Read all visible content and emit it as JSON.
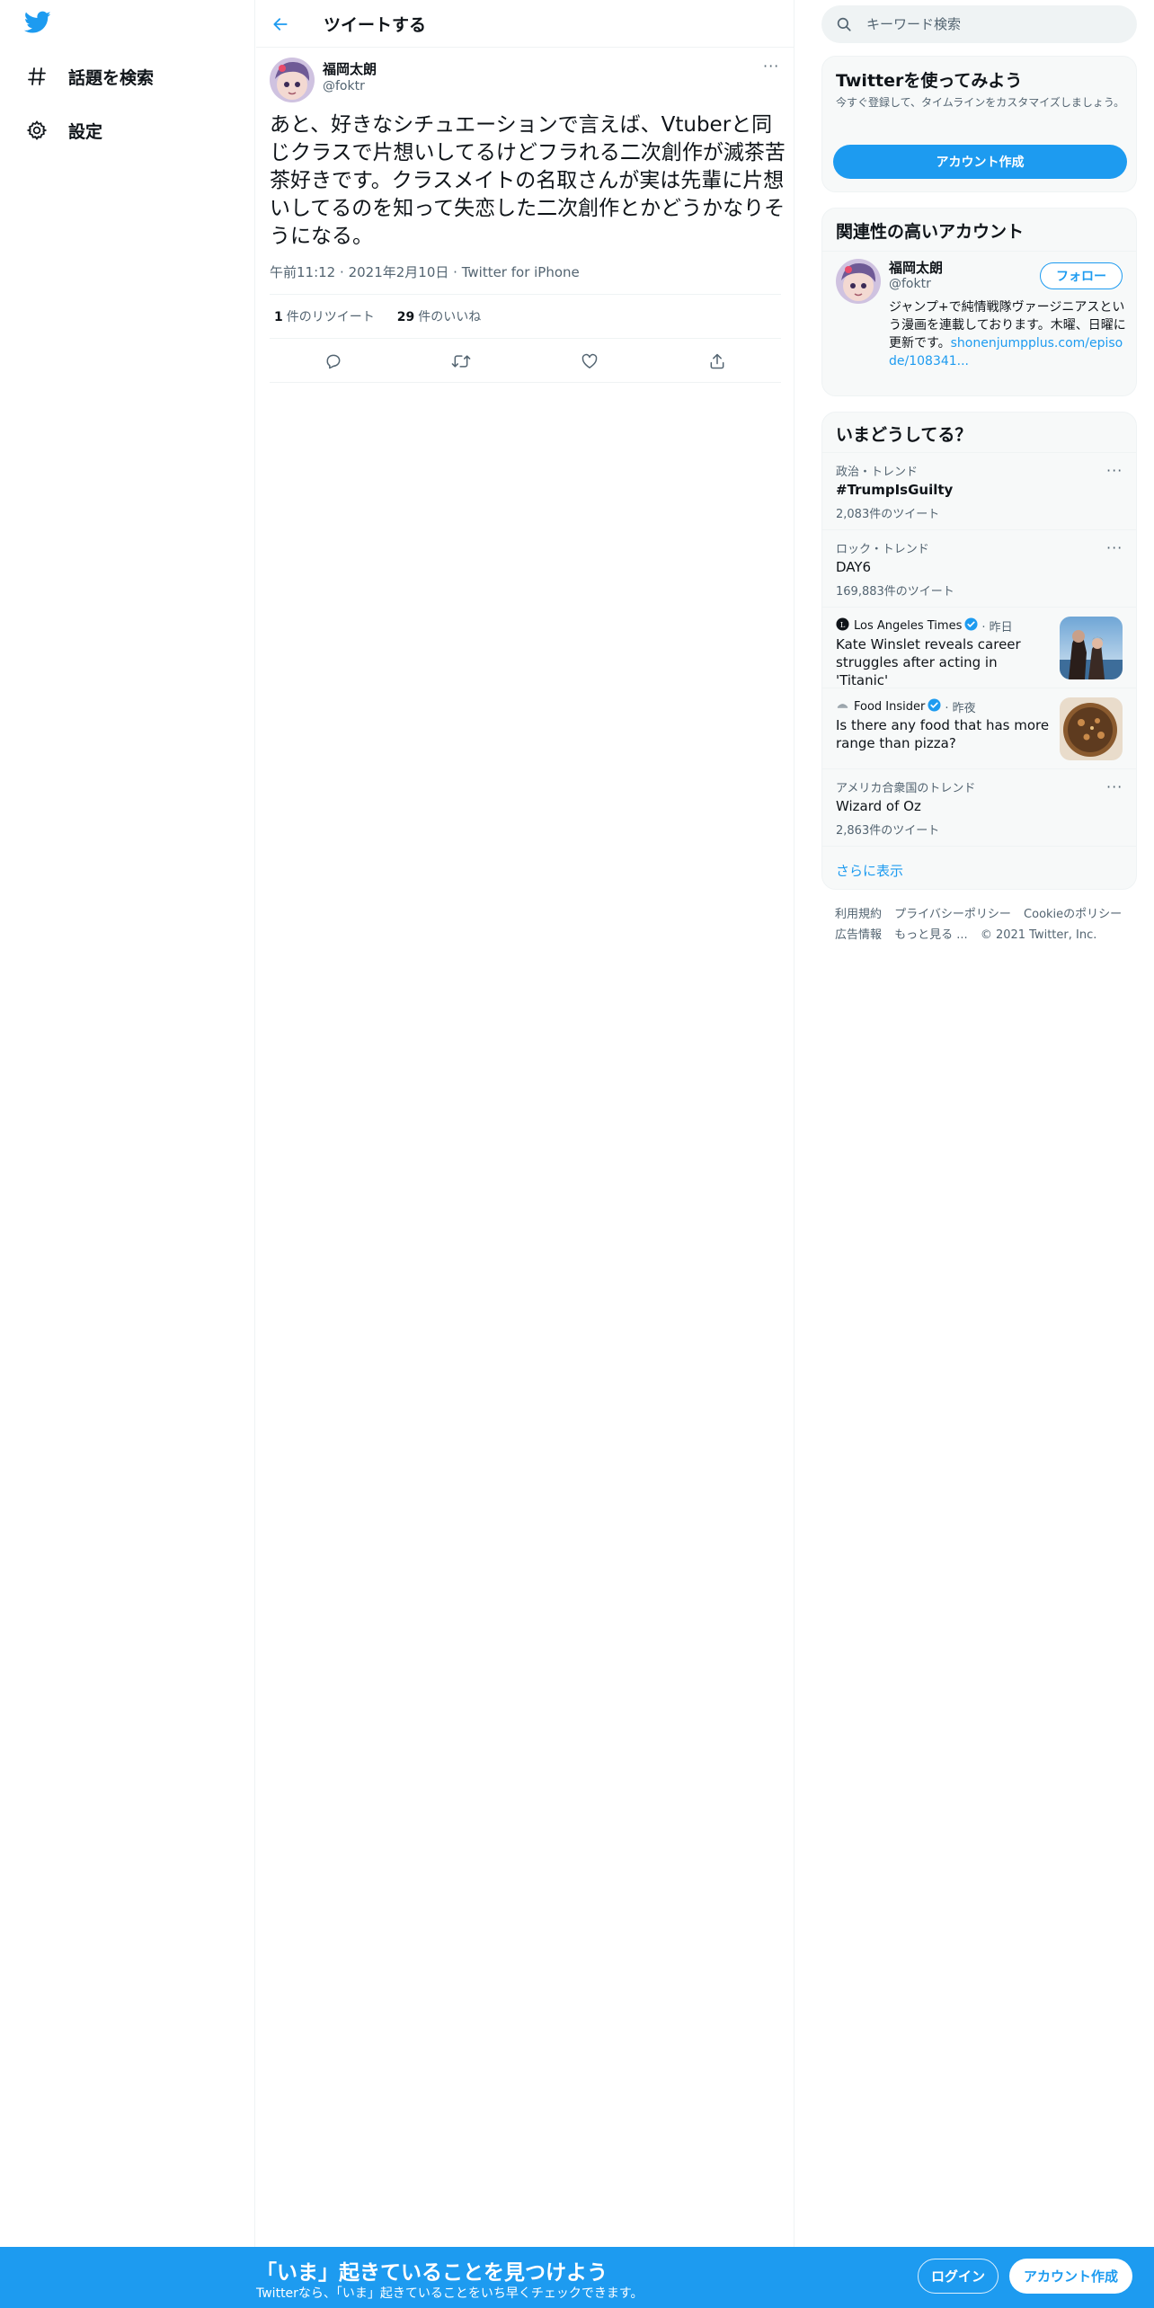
{
  "colors": {
    "accent": "#1d9bf0",
    "text": "#0f1419",
    "secondary": "#536471",
    "border": "#eff3f4",
    "panel": "#f7f9f9"
  },
  "left_nav": {
    "logo_icon": "twitter-bird-icon",
    "items": [
      {
        "label": "話題を検索",
        "icon": "hashtag-icon"
      },
      {
        "label": "設定",
        "icon": "gear-icon"
      }
    ]
  },
  "header": {
    "back_icon": "arrow-left-icon",
    "title": "ツイートする"
  },
  "tweet": {
    "author_name": "福岡太朗",
    "author_handle": "@foktr",
    "more_icon": "ellipsis-icon",
    "text": "あと、好きなシチュエーションで言えば、Vtuberと同じクラスで片想いしてるけどフラれる二次創作が滅茶苦茶好きです。クラスメイトの名取さんが実は先輩に片想いしてるのを知って失恋した二次創作とかどうかなりそうになる。",
    "time": "午前11:12",
    "date": "2021年2月10日",
    "source": "Twitter for iPhone",
    "retweet_count": "1",
    "retweet_label": "件のリツイート",
    "like_count": "29",
    "like_label": "件のいいね",
    "action_icons": [
      "reply-icon",
      "retweet-icon",
      "like-icon",
      "share-icon"
    ]
  },
  "search": {
    "placeholder": "キーワード検索",
    "icon": "search-icon"
  },
  "signup_card": {
    "title": "Twitterを使ってみよう",
    "description": "今すぐ登録して、タイムラインをカスタマイズしましょう。",
    "button": "アカウント作成"
  },
  "related": {
    "title": "関連性の高いアカウント",
    "name": "福岡太朗",
    "handle": "@foktr",
    "follow_button": "フォロー",
    "bio": "ジャンプ+で純情戦隊ヴァージニアスという漫画を連載しております。木曜、日曜に更新です。",
    "bio_link": "shonenjumpplus.com/episode/108341..."
  },
  "trends": {
    "title": "いまどうしてる？",
    "items": [
      {
        "meta": "政治・トレンド",
        "title": "#TrumpIsGuilty",
        "count": "2,083件のツイート"
      },
      {
        "meta": "ロック・トレンド",
        "title": "DAY6",
        "count": "169,883件のツイート"
      },
      {
        "meta": "アメリカ合衆国のトレンド",
        "title": "Wizard of Oz",
        "count": "2,863件のツイート"
      }
    ],
    "news": [
      {
        "source": "Los Angeles Times",
        "time": "昨日",
        "headline": "Kate Winslet reveals career struggles after acting in 'Titanic'"
      },
      {
        "source": "Food Insider",
        "time": "昨夜",
        "headline": "Is there any food that has more range than pizza?"
      }
    ],
    "show_more": "さらに表示"
  },
  "footer": {
    "links": [
      "利用規約",
      "プライバシーポリシー",
      "Cookieのポリシー",
      "広告情報",
      "もっと見る ..."
    ],
    "copyright": "© 2021 Twitter, Inc."
  },
  "bottom_bar": {
    "title": "「いま」起きていることを見つけよう",
    "subtitle": "Twitterなら、「いま」起きていることをいち早くチェックできます。",
    "login": "ログイン",
    "signup": "アカウント作成"
  }
}
